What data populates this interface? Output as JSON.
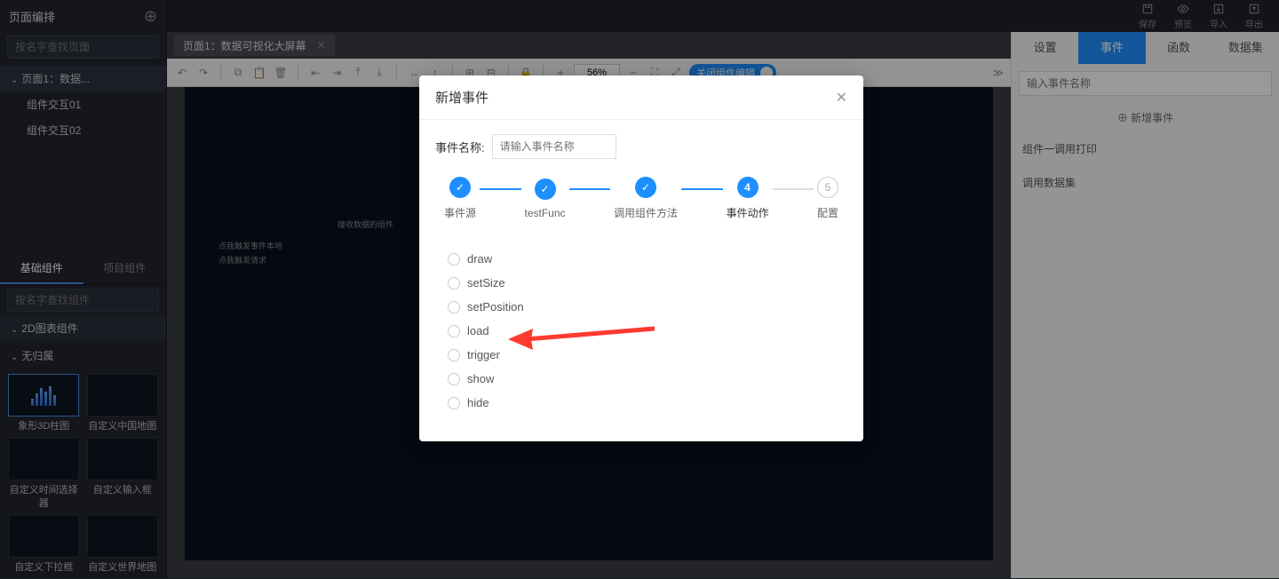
{
  "top_actions": [
    {
      "icon": "save",
      "label": "保存"
    },
    {
      "icon": "preview",
      "label": "预览"
    },
    {
      "icon": "import",
      "label": "导入"
    },
    {
      "icon": "export",
      "label": "导出"
    }
  ],
  "left": {
    "title": "页面编排",
    "search_placeholder": "按名字查找页面",
    "page_node": "页面1：数据...",
    "children": [
      "组件交互01",
      "组件交互02"
    ],
    "tabs": [
      "基础组件",
      "项目组件"
    ],
    "search2_placeholder": "按名字查找组件",
    "cat1": "2D图表组件",
    "cat2": "无归属",
    "thumbs": [
      "象形3D柱图",
      "自定义中国地图",
      "自定义时间选择器",
      "自定义输入框",
      "自定义下拉框",
      "自定义世界地图"
    ]
  },
  "center": {
    "tab_label": "页面1：数据可视化大屏幕",
    "zoom": "56%",
    "toggle_label": "关闭组件编辑",
    "canvas_text": [
      "接收数据的组件",
      "点我触发事件本地",
      "点我触发请求"
    ]
  },
  "right": {
    "tabs": [
      "设置",
      "事件",
      "函数",
      "数据集"
    ],
    "active_tab": 1,
    "search_placeholder": "输入事件名称",
    "add_label": "新增事件",
    "items": [
      "组件一调用打印",
      "调用数据集"
    ]
  },
  "modal": {
    "title": "新增事件",
    "name_label": "事件名称:",
    "name_placeholder": "请输入事件名称",
    "steps": [
      {
        "label": "事件源",
        "state": "done"
      },
      {
        "label": "testFunc",
        "state": "done"
      },
      {
        "label": "调用组件方法",
        "state": "done"
      },
      {
        "label": "事件动作",
        "state": "current",
        "num": "4"
      },
      {
        "label": "配置",
        "state": "pending",
        "num": "5"
      }
    ],
    "options": [
      "draw",
      "setSize",
      "setPosition",
      "load",
      "trigger",
      "show",
      "hide"
    ]
  }
}
